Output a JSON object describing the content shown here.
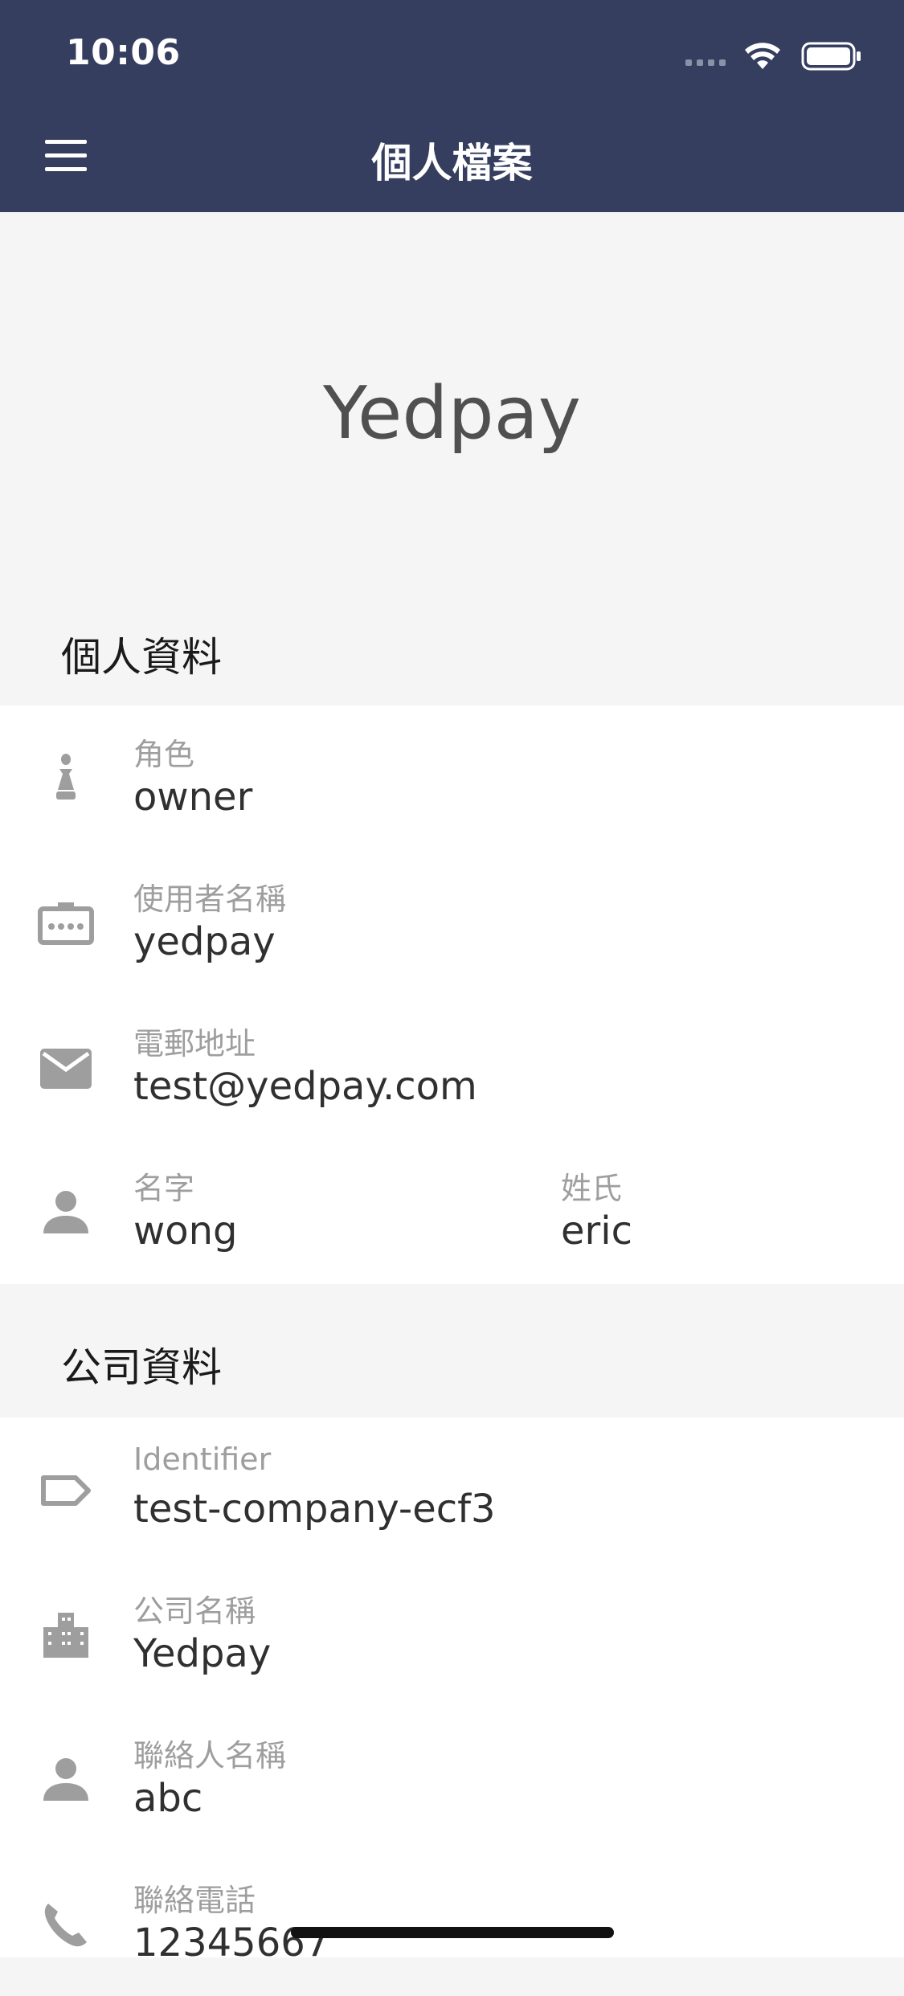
{
  "status_bar": {
    "time": "10:06"
  },
  "header": {
    "title": "個人檔案"
  },
  "hero": {
    "text": "Yedpay"
  },
  "personal": {
    "heading": "個人資料",
    "role": {
      "label": "角色",
      "value": "owner"
    },
    "username": {
      "label": "使用者名稱",
      "value": "yedpay"
    },
    "email": {
      "label": "電郵地址",
      "value": "test@yedpay.com"
    },
    "first_name": {
      "label": "名字",
      "value": "wong"
    },
    "last_name": {
      "label": "姓氏",
      "value": "eric"
    }
  },
  "company": {
    "heading": "公司資料",
    "identifier": {
      "label": "Identifier",
      "value": "test-company-ecf3"
    },
    "company_name": {
      "label": "公司名稱",
      "value": "Yedpay"
    },
    "contact_name": {
      "label": "聯絡人名稱",
      "value": "abc"
    },
    "contact_phone": {
      "label": "聯絡電話",
      "value": "12345667"
    }
  },
  "icons": {
    "role": "chess-pawn-icon",
    "username": "badge-icon",
    "email": "mail-icon",
    "name": "person-icon",
    "identifier": "label-tag-icon",
    "company": "building-icon",
    "contact": "person-icon",
    "phone": "phone-icon"
  },
  "colors": {
    "header_bg": "#353e5f",
    "page_bg": "#f5f5f5",
    "icon": "#9e9e9e",
    "label": "#9e9e9e",
    "value": "#303030"
  }
}
